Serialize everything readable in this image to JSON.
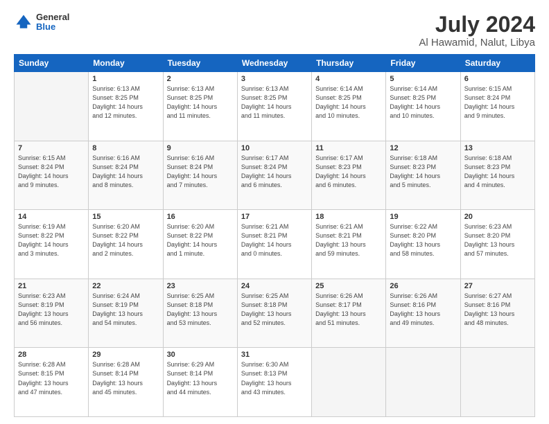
{
  "logo": {
    "general": "General",
    "blue": "Blue"
  },
  "header": {
    "title": "July 2024",
    "subtitle": "Al Hawamid, Nalut, Libya"
  },
  "weekdays": [
    "Sunday",
    "Monday",
    "Tuesday",
    "Wednesday",
    "Thursday",
    "Friday",
    "Saturday"
  ],
  "weeks": [
    [
      {
        "day": "",
        "info": ""
      },
      {
        "day": "1",
        "info": "Sunrise: 6:13 AM\nSunset: 8:25 PM\nDaylight: 14 hours\nand 12 minutes."
      },
      {
        "day": "2",
        "info": "Sunrise: 6:13 AM\nSunset: 8:25 PM\nDaylight: 14 hours\nand 11 minutes."
      },
      {
        "day": "3",
        "info": "Sunrise: 6:13 AM\nSunset: 8:25 PM\nDaylight: 14 hours\nand 11 minutes."
      },
      {
        "day": "4",
        "info": "Sunrise: 6:14 AM\nSunset: 8:25 PM\nDaylight: 14 hours\nand 10 minutes."
      },
      {
        "day": "5",
        "info": "Sunrise: 6:14 AM\nSunset: 8:25 PM\nDaylight: 14 hours\nand 10 minutes."
      },
      {
        "day": "6",
        "info": "Sunrise: 6:15 AM\nSunset: 8:24 PM\nDaylight: 14 hours\nand 9 minutes."
      }
    ],
    [
      {
        "day": "7",
        "info": "Sunrise: 6:15 AM\nSunset: 8:24 PM\nDaylight: 14 hours\nand 9 minutes."
      },
      {
        "day": "8",
        "info": "Sunrise: 6:16 AM\nSunset: 8:24 PM\nDaylight: 14 hours\nand 8 minutes."
      },
      {
        "day": "9",
        "info": "Sunrise: 6:16 AM\nSunset: 8:24 PM\nDaylight: 14 hours\nand 7 minutes."
      },
      {
        "day": "10",
        "info": "Sunrise: 6:17 AM\nSunset: 8:24 PM\nDaylight: 14 hours\nand 6 minutes."
      },
      {
        "day": "11",
        "info": "Sunrise: 6:17 AM\nSunset: 8:23 PM\nDaylight: 14 hours\nand 6 minutes."
      },
      {
        "day": "12",
        "info": "Sunrise: 6:18 AM\nSunset: 8:23 PM\nDaylight: 14 hours\nand 5 minutes."
      },
      {
        "day": "13",
        "info": "Sunrise: 6:18 AM\nSunset: 8:23 PM\nDaylight: 14 hours\nand 4 minutes."
      }
    ],
    [
      {
        "day": "14",
        "info": "Sunrise: 6:19 AM\nSunset: 8:22 PM\nDaylight: 14 hours\nand 3 minutes."
      },
      {
        "day": "15",
        "info": "Sunrise: 6:20 AM\nSunset: 8:22 PM\nDaylight: 14 hours\nand 2 minutes."
      },
      {
        "day": "16",
        "info": "Sunrise: 6:20 AM\nSunset: 8:22 PM\nDaylight: 14 hours\nand 1 minute."
      },
      {
        "day": "17",
        "info": "Sunrise: 6:21 AM\nSunset: 8:21 PM\nDaylight: 14 hours\nand 0 minutes."
      },
      {
        "day": "18",
        "info": "Sunrise: 6:21 AM\nSunset: 8:21 PM\nDaylight: 13 hours\nand 59 minutes."
      },
      {
        "day": "19",
        "info": "Sunrise: 6:22 AM\nSunset: 8:20 PM\nDaylight: 13 hours\nand 58 minutes."
      },
      {
        "day": "20",
        "info": "Sunrise: 6:23 AM\nSunset: 8:20 PM\nDaylight: 13 hours\nand 57 minutes."
      }
    ],
    [
      {
        "day": "21",
        "info": "Sunrise: 6:23 AM\nSunset: 8:19 PM\nDaylight: 13 hours\nand 56 minutes."
      },
      {
        "day": "22",
        "info": "Sunrise: 6:24 AM\nSunset: 8:19 PM\nDaylight: 13 hours\nand 54 minutes."
      },
      {
        "day": "23",
        "info": "Sunrise: 6:25 AM\nSunset: 8:18 PM\nDaylight: 13 hours\nand 53 minutes."
      },
      {
        "day": "24",
        "info": "Sunrise: 6:25 AM\nSunset: 8:18 PM\nDaylight: 13 hours\nand 52 minutes."
      },
      {
        "day": "25",
        "info": "Sunrise: 6:26 AM\nSunset: 8:17 PM\nDaylight: 13 hours\nand 51 minutes."
      },
      {
        "day": "26",
        "info": "Sunrise: 6:26 AM\nSunset: 8:16 PM\nDaylight: 13 hours\nand 49 minutes."
      },
      {
        "day": "27",
        "info": "Sunrise: 6:27 AM\nSunset: 8:16 PM\nDaylight: 13 hours\nand 48 minutes."
      }
    ],
    [
      {
        "day": "28",
        "info": "Sunrise: 6:28 AM\nSunset: 8:15 PM\nDaylight: 13 hours\nand 47 minutes."
      },
      {
        "day": "29",
        "info": "Sunrise: 6:28 AM\nSunset: 8:14 PM\nDaylight: 13 hours\nand 45 minutes."
      },
      {
        "day": "30",
        "info": "Sunrise: 6:29 AM\nSunset: 8:14 PM\nDaylight: 13 hours\nand 44 minutes."
      },
      {
        "day": "31",
        "info": "Sunrise: 6:30 AM\nSunset: 8:13 PM\nDaylight: 13 hours\nand 43 minutes."
      },
      {
        "day": "",
        "info": ""
      },
      {
        "day": "",
        "info": ""
      },
      {
        "day": "",
        "info": ""
      }
    ]
  ]
}
